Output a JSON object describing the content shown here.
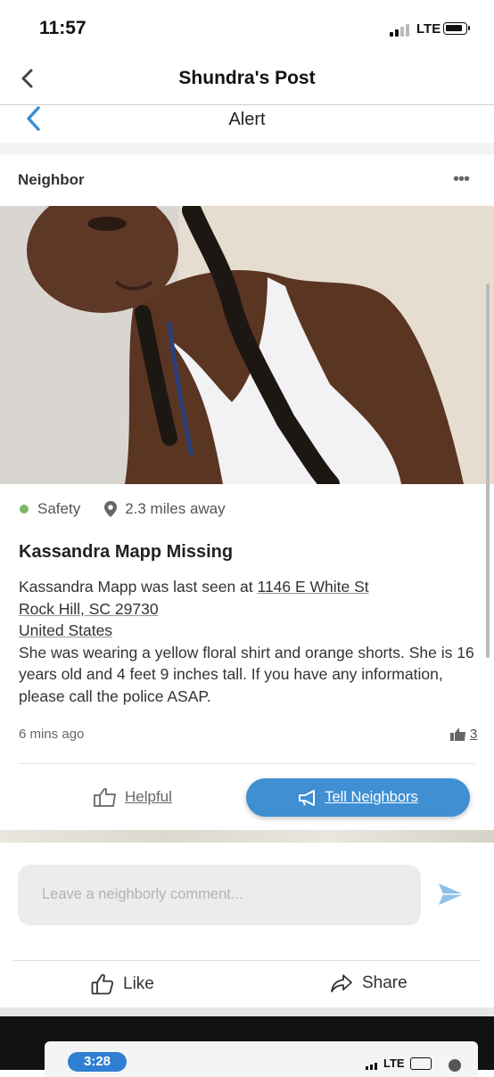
{
  "status_bar": {
    "time": "11:57",
    "network": "LTE"
  },
  "nav": {
    "title": "Shundra's Post"
  },
  "alert_bar": {
    "title": "Alert"
  },
  "post": {
    "author_type": "Neighbor",
    "more_label": "•••",
    "category": "Safety",
    "distance": "2.3 miles away",
    "title": "Kassandra Mapp Missing",
    "body_prefix": "Kassandra Mapp was last seen at ",
    "address_line1": "1146 E White St",
    "address_line2": "Rock Hill, SC  29730",
    "address_line3": "United States",
    "body_rest": "She was wearing a yellow floral shirt and orange shorts. She is 16 years old and 4 feet 9 inches tall. If you have any information, please call the police ASAP.",
    "time_ago": "6 mins ago",
    "helpful_count": "3",
    "helpful_label": "Helpful",
    "tell_neighbors_label": "Tell Neighbors",
    "category_color": "#7cb76b",
    "accent_color": "#3f8fd2"
  },
  "comment": {
    "placeholder": "Leave a neighborly comment...",
    "send_icon": "send-icon"
  },
  "actions": {
    "like_label": "Like",
    "share_label": "Share"
  },
  "mini_status": {
    "time": "3:28",
    "network": "LTE"
  }
}
